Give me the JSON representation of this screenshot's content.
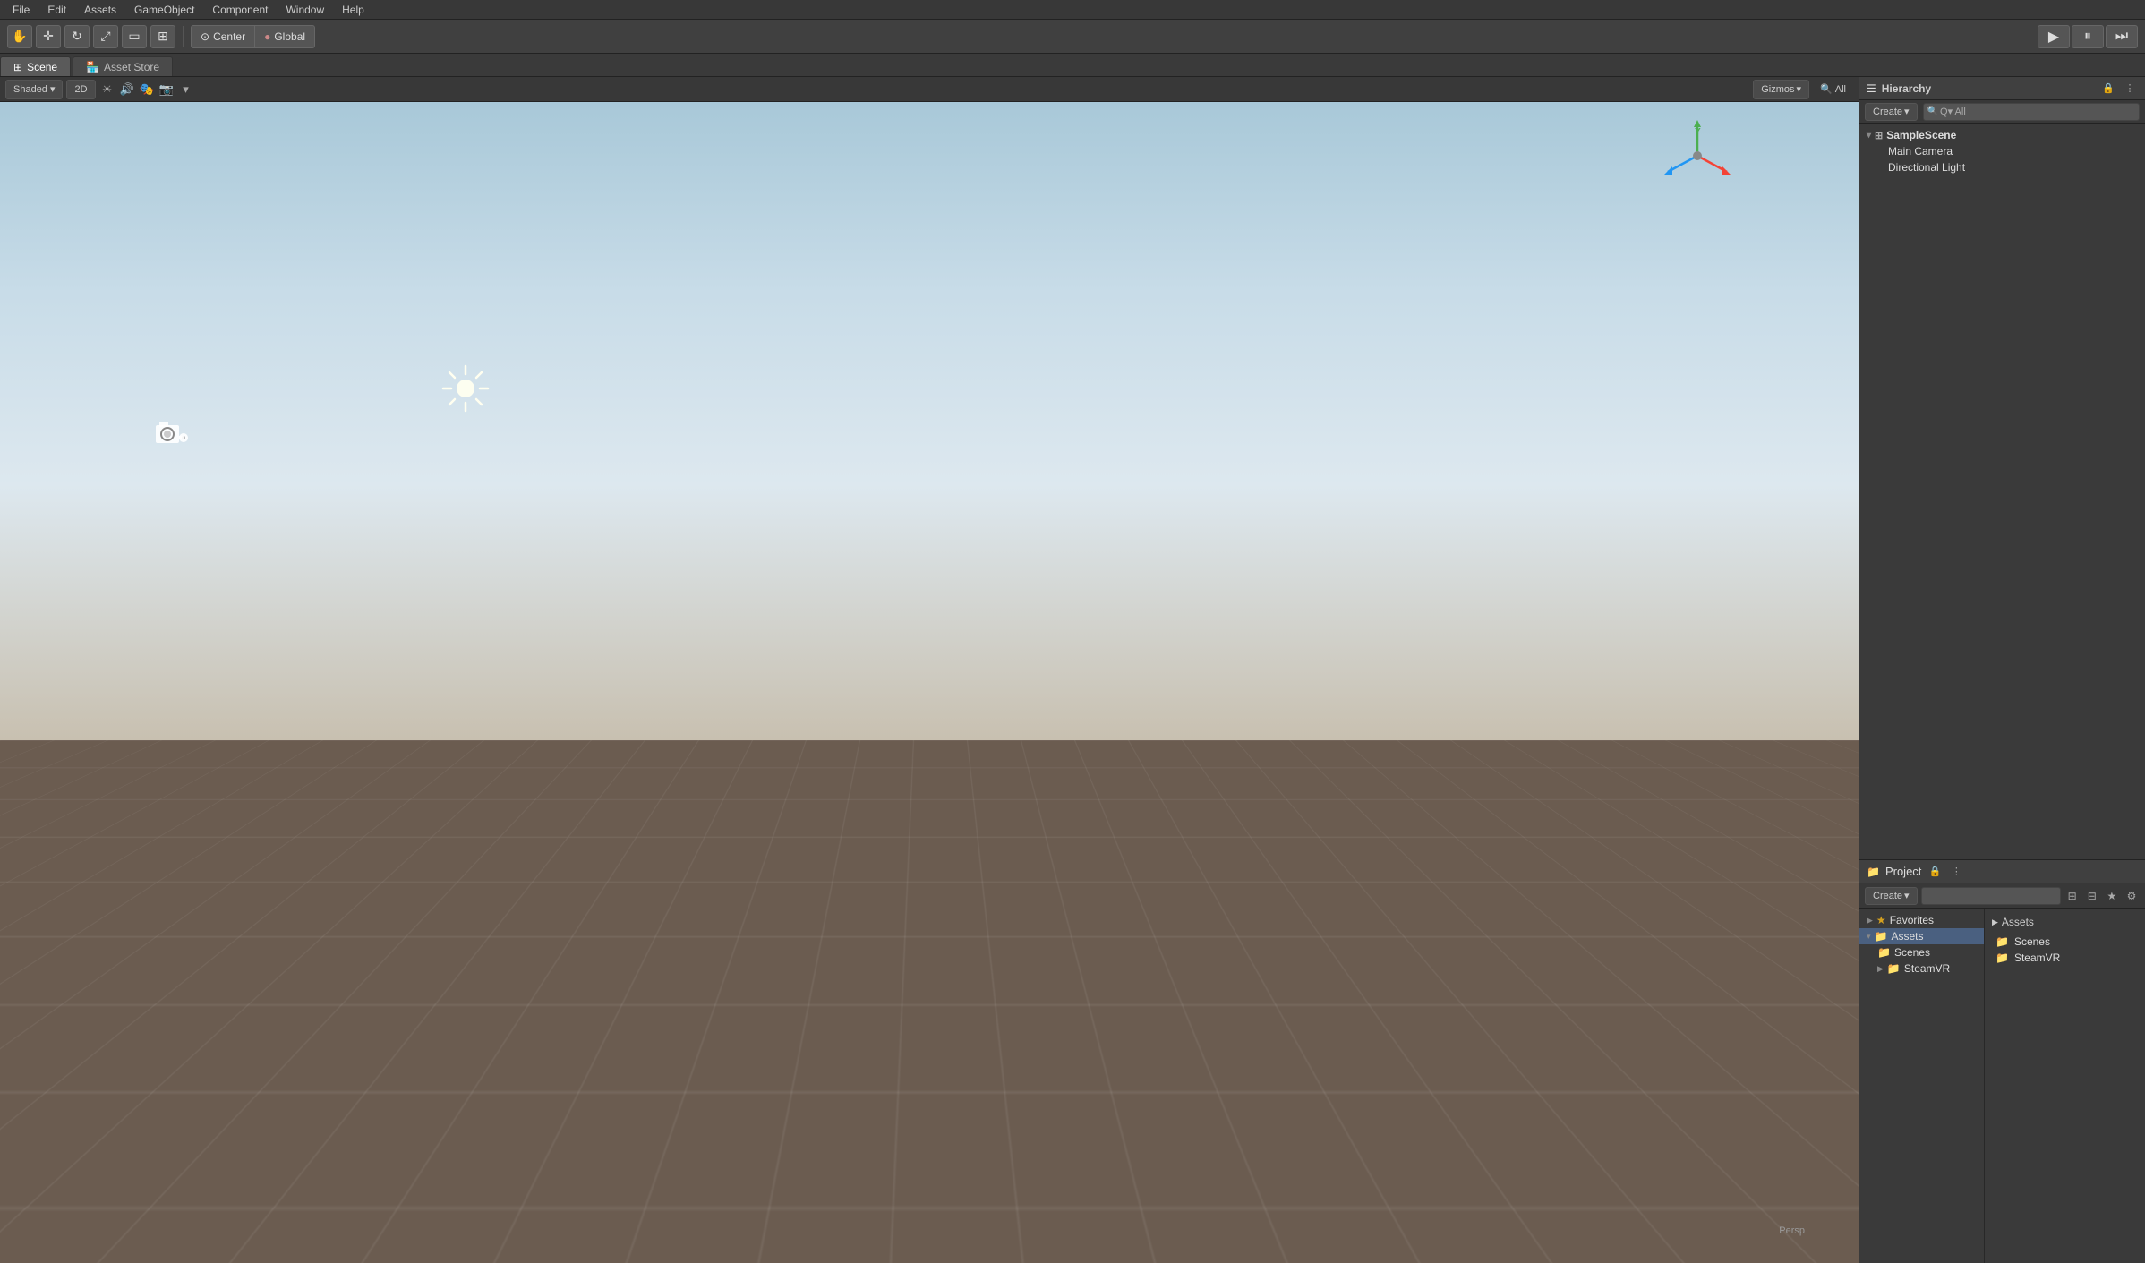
{
  "menubar": {
    "items": [
      "File",
      "Edit",
      "Assets",
      "GameObject",
      "Component",
      "Window",
      "Help"
    ]
  },
  "toolbar": {
    "transform_tools": [
      "hand",
      "move",
      "rotate",
      "scale",
      "rect",
      "combined"
    ],
    "center_label": "Center",
    "global_label": "Global",
    "play_controls": [
      "play",
      "pause",
      "step"
    ]
  },
  "tabs": {
    "scene_tab": "Scene",
    "asset_store_tab": "Asset Store"
  },
  "scene_toolbar": {
    "shaded_label": "Shaded",
    "twod_label": "2D",
    "gizmos_label": "Gizmos",
    "all_label": "All"
  },
  "viewport": {
    "persp_label": "Persp"
  },
  "hierarchy": {
    "title": "Hierarchy",
    "create_label": "Create",
    "search_placeholder": "Q▾ All",
    "scene_name": "SampleScene",
    "items": [
      {
        "name": "Main Camera",
        "indent": 1
      },
      {
        "name": "Directional Light",
        "indent": 1
      }
    ]
  },
  "project": {
    "title": "Project",
    "create_label": "Create",
    "search_placeholder": "",
    "left_tree": [
      {
        "label": "Favorites",
        "icon": "star",
        "indent": 0
      },
      {
        "label": "Assets",
        "icon": "folder",
        "indent": 0,
        "expanded": true
      },
      {
        "label": "Scenes",
        "icon": "folder",
        "indent": 1
      },
      {
        "label": "SteamVR",
        "icon": "folder",
        "indent": 1,
        "has_arrow": true
      }
    ],
    "right_header": "Assets",
    "right_items": [
      {
        "label": "Scenes",
        "icon": "folder"
      },
      {
        "label": "SteamVR",
        "icon": "folder"
      }
    ]
  }
}
